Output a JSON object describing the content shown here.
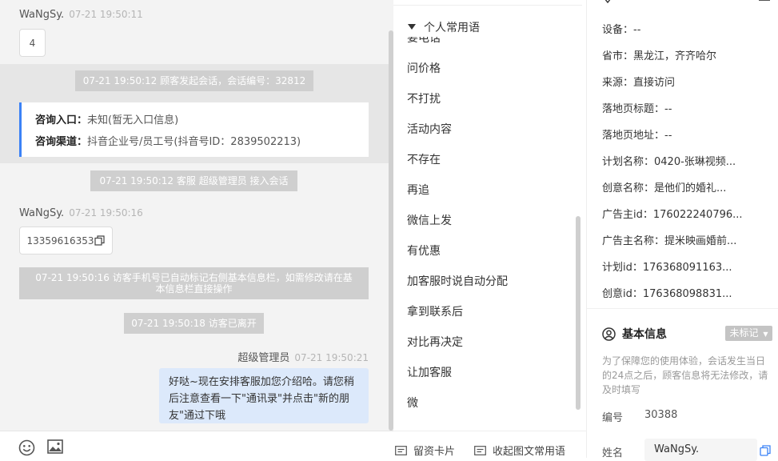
{
  "chat": {
    "msg1": {
      "sender": "WaNgSy.",
      "time": "07-21 19:50:11",
      "text": "4"
    },
    "sys1": "07-21 19:50:12 顾客发起会话，会话编号：32812",
    "consult": {
      "entry_label": "咨询入口：",
      "entry_value": "未知(暂无入口信息)",
      "channel_label": "咨询渠道：",
      "channel_value": "抖音企业号/员工号(抖音号ID：2839502213)"
    },
    "sys2": "07-21 19:50:12 客服 超级管理员 接入会话",
    "msg2": {
      "sender": "WaNgSy.",
      "time": "07-21 19:50:16",
      "text": "13359616353"
    },
    "sys3_line1": "07-21 19:50:16 访客手机号已自动标记右侧基本信息栏，如需修改请在基",
    "sys3_line2": "本信息栏直接操作",
    "sys4": "07-21 19:50:18 访客已离开",
    "msg3": {
      "sender": "超级管理员",
      "time": "07-21 19:50:21",
      "line1": "好哒~现在安排客服加您介绍哈。请您稍",
      "line2": "后注意查看一下\"通讯录\"并点击\"新的朋",
      "line3": "友\"通过下哦"
    }
  },
  "phrases": {
    "header": "个人常用语",
    "items": [
      "要电话",
      "问价格",
      "不打扰",
      "活动内容",
      "不存在",
      "再追",
      "微信上发",
      "有优惠",
      "加客服时说自动分配",
      "拿到联系后",
      "对比再决定",
      "让加客服",
      "微"
    ]
  },
  "mid_bottom": {
    "card_label": "留资卡片",
    "collect_label": "收起图文常用语"
  },
  "visitor_info": {
    "device_label": "设备：",
    "device_value": "--",
    "province_label": "省市：",
    "province_value": "黑龙江，齐齐哈尔",
    "source_label": "来源：",
    "source_value": "直接访问",
    "landing_title_label": "落地页标题：",
    "landing_title_value": "--",
    "landing_url_label": "落地页地址：",
    "landing_url_value": "--",
    "plan_name_label": "计划名称：",
    "plan_name_value": "0420-张琳视频...",
    "creative_name_label": "创意名称：",
    "creative_name_value": "是他们的婚礼...",
    "advertiser_id_label": "广告主id：",
    "advertiser_id_value": "176022240796...",
    "advertiser_name_label": "广告主名称：",
    "advertiser_name_value": "提米映画婚前...",
    "plan_id_label": "计划id：",
    "plan_id_value": "176368091163...",
    "creative_id_label": "创意id：",
    "creative_id_value": "176368098831..."
  },
  "basic_info": {
    "title": "基本信息",
    "mark": "未标记",
    "notice_line1": "为了保障您的使用体验，会话发生当日",
    "notice_line2": "的24点之后，顾客信息将无法修改，请",
    "notice_line3": "及时填写",
    "id_label": "编号",
    "id_value": "30388",
    "name_label": "姓名",
    "name_value": "WaNgSy."
  }
}
